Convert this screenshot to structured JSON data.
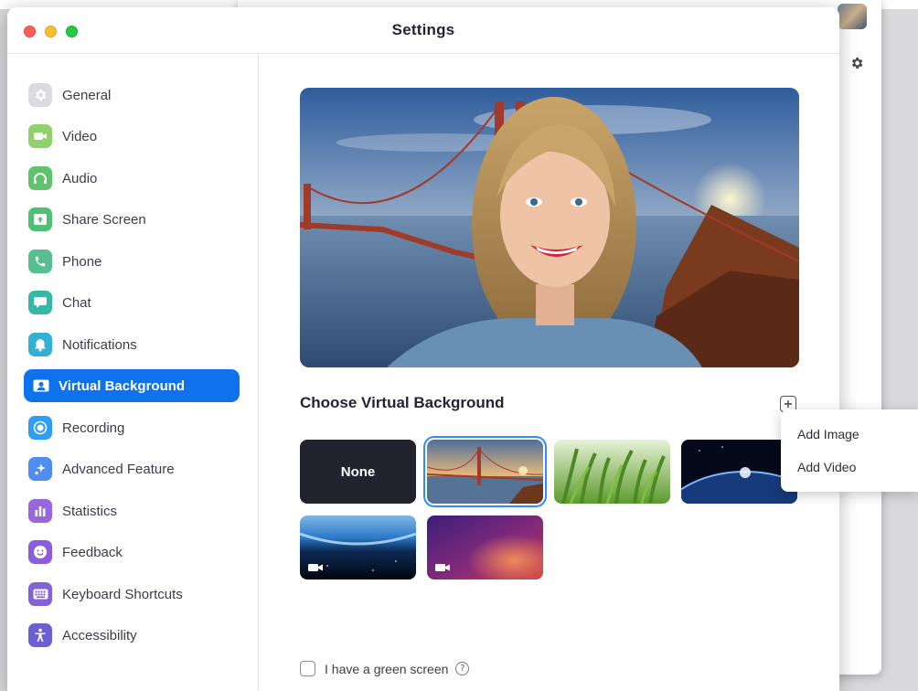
{
  "window": {
    "title": "Settings"
  },
  "sidebar": {
    "items": [
      {
        "label": "General",
        "icon": "gear-icon",
        "color": "#d9d9de",
        "active": false
      },
      {
        "label": "Video",
        "icon": "video-camera-icon",
        "color": "#8fd16a",
        "active": false
      },
      {
        "label": "Audio",
        "icon": "headphones-icon",
        "color": "#5ec36b",
        "active": false
      },
      {
        "label": "Share Screen",
        "icon": "share-screen-icon",
        "color": "#4fbf74",
        "active": false
      },
      {
        "label": "Phone",
        "icon": "phone-icon",
        "color": "#57bf8f",
        "active": false
      },
      {
        "label": "Chat",
        "icon": "chat-bubble-icon",
        "color": "#36b8a8",
        "active": false
      },
      {
        "label": "Notifications",
        "icon": "bell-icon",
        "color": "#33b1d4",
        "active": false
      },
      {
        "label": "Virtual Background",
        "icon": "person-card-icon",
        "color": "#0e72ed",
        "active": true
      },
      {
        "label": "Recording",
        "icon": "record-icon",
        "color": "#2f9ef2",
        "active": false
      },
      {
        "label": "Advanced Feature",
        "icon": "sparkles-icon",
        "color": "#4f8ef0",
        "active": false
      },
      {
        "label": "Statistics",
        "icon": "bar-chart-icon",
        "color": "#9866dd",
        "active": false
      },
      {
        "label": "Feedback",
        "icon": "smiley-icon",
        "color": "#8b5fdc",
        "active": false
      },
      {
        "label": "Keyboard Shortcuts",
        "icon": "keyboard-icon",
        "color": "#8262d6",
        "active": false
      },
      {
        "label": "Accessibility",
        "icon": "accessibility-icon",
        "color": "#6c5fd6",
        "active": false
      }
    ]
  },
  "main": {
    "section_title": "Choose Virtual Background",
    "thumbnails": [
      {
        "name": "none",
        "label": "None",
        "selected": false,
        "video": false
      },
      {
        "name": "golden-gate",
        "selected": true,
        "video": false
      },
      {
        "name": "grass",
        "selected": false,
        "video": false
      },
      {
        "name": "earth-space",
        "selected": false,
        "video": false
      },
      {
        "name": "earth-horizon",
        "selected": false,
        "video": true
      },
      {
        "name": "purple-gradient",
        "selected": false,
        "video": true
      }
    ],
    "green_screen_label": "I have a green screen",
    "green_screen_checked": false,
    "help_glyph": "?"
  },
  "add_menu": {
    "items": [
      "Add Image",
      "Add Video"
    ]
  },
  "colors": {
    "accent": "#0e72ed",
    "selection_ring": "#2d8cff"
  }
}
